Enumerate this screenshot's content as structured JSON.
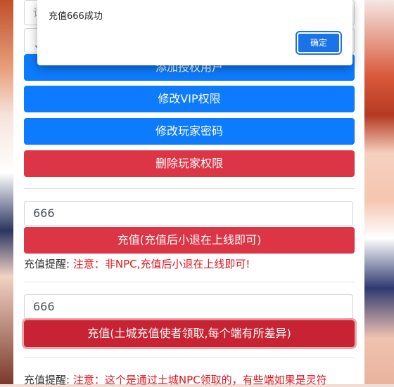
{
  "dialog": {
    "message": "充值666成功",
    "ok_label": "确定"
  },
  "top_fields": {
    "field1_partial": "请",
    "select_partial": "⌄"
  },
  "buttons": {
    "add_auth": "添加授权用户",
    "modify_vip": "修改VIP权限",
    "modify_password": "修改玩家密码",
    "delete_auth": "删除玩家权限"
  },
  "recharge1": {
    "amount": "666",
    "button_label": "充值(充值后小退在上线即可)",
    "note_label": "充值提醒:",
    "note_warning": "注意：非NPC,充值后小退在上线即可!"
  },
  "recharge2": {
    "amount": "666",
    "button_label": "充值(土城充值使者领取,每个端有所差异)",
    "note_label": "充值提醒:",
    "note_warning": "注意：这个是通过土城NPC领取的，有些端如果是灵符"
  },
  "colors": {
    "primary": "#0d7bfd",
    "danger": "#dc3545",
    "warning_text": "#e0141e"
  }
}
